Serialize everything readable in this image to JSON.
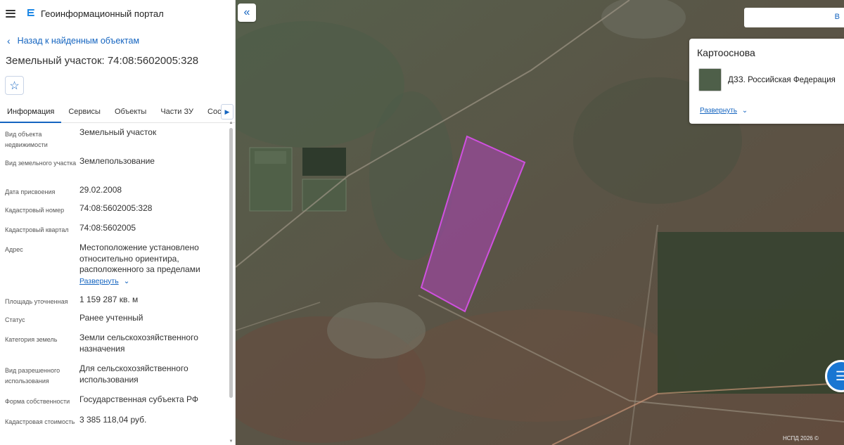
{
  "app": {
    "title": "Геоинформационный портал"
  },
  "nav": {
    "back_label": "Назад к найденным объектам"
  },
  "object": {
    "title": "Земельный участок: 74:08:5602005:328"
  },
  "tabs": [
    {
      "label": "Информация",
      "active": true
    },
    {
      "label": "Сервисы"
    },
    {
      "label": "Объекты"
    },
    {
      "label": "Части ЗУ"
    },
    {
      "label": "Состав"
    }
  ],
  "fields": [
    {
      "label": "Вид объекта недвижимости",
      "value": "Земельный участок"
    },
    {
      "label": "Вид земельного участка",
      "value": "Землепользование"
    },
    {
      "label": "Дата присвоения",
      "value": "29.02.2008"
    },
    {
      "label": "Кадастровый номер",
      "value": "74:08:5602005:328"
    },
    {
      "label": "Кадастровый квартал",
      "value": "74:08:5602005"
    },
    {
      "label": "Адрес",
      "value": "Местоположение установлено относительно ориентира, расположенного за пределами"
    },
    {
      "label": "Площадь уточненная",
      "value": "1 159 287 кв. м"
    },
    {
      "label": "Статус",
      "value": "Ранее учтенный"
    },
    {
      "label": "Категория земель",
      "value": "Земли сельскохозяйственного назначения"
    },
    {
      "label": "Вид разрешенного использования",
      "value": "Для сельскохозяйственного использования"
    },
    {
      "label": "Форма собственности",
      "value": "Государственная субъекта РФ"
    },
    {
      "label": "Кадастровая стоимость",
      "value": "3 385 118,04 руб."
    }
  ],
  "address_expand_label": "Развернуть",
  "map": {
    "search_partial": "В",
    "basemap_title": "Картооснова",
    "basemap_layer": "ДЗЗ. Российская Федерация",
    "basemap_expand": "Развернуть",
    "copyright": "НСПД 2026 ©",
    "highlight_color": "#c040d0"
  }
}
